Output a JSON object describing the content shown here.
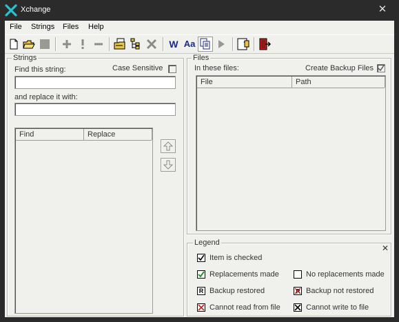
{
  "window": {
    "title": "Xchange"
  },
  "menu": [
    "File",
    "Strings",
    "Files",
    "Help"
  ],
  "toolbar": {
    "word_label": "W",
    "case_label": "Aa"
  },
  "strings": {
    "group_label": "Strings",
    "find_label": "Find this string:",
    "case_sensitive_label": "Case Sensitive",
    "replace_label": "and replace it with:",
    "find_value": "",
    "replace_value": "",
    "columns": [
      "Find",
      "Replace"
    ]
  },
  "files": {
    "group_label": "Files",
    "in_files_label": "In these files:",
    "backup_label": "Create Backup Files",
    "columns": [
      "File",
      "Path"
    ]
  },
  "legend": {
    "group_label": "Legend",
    "items": [
      "Item is checked",
      "Replacements made",
      "No replacements made",
      "Backup restored",
      "Backup not restored",
      "Cannot read from file",
      "Cannot write to file"
    ]
  },
  "colors": {
    "accent_icon": "#27c4d6",
    "green_check": "#1a9a1a",
    "red_mark": "#cc1a1a",
    "navy_text": "#1a2a8a"
  }
}
